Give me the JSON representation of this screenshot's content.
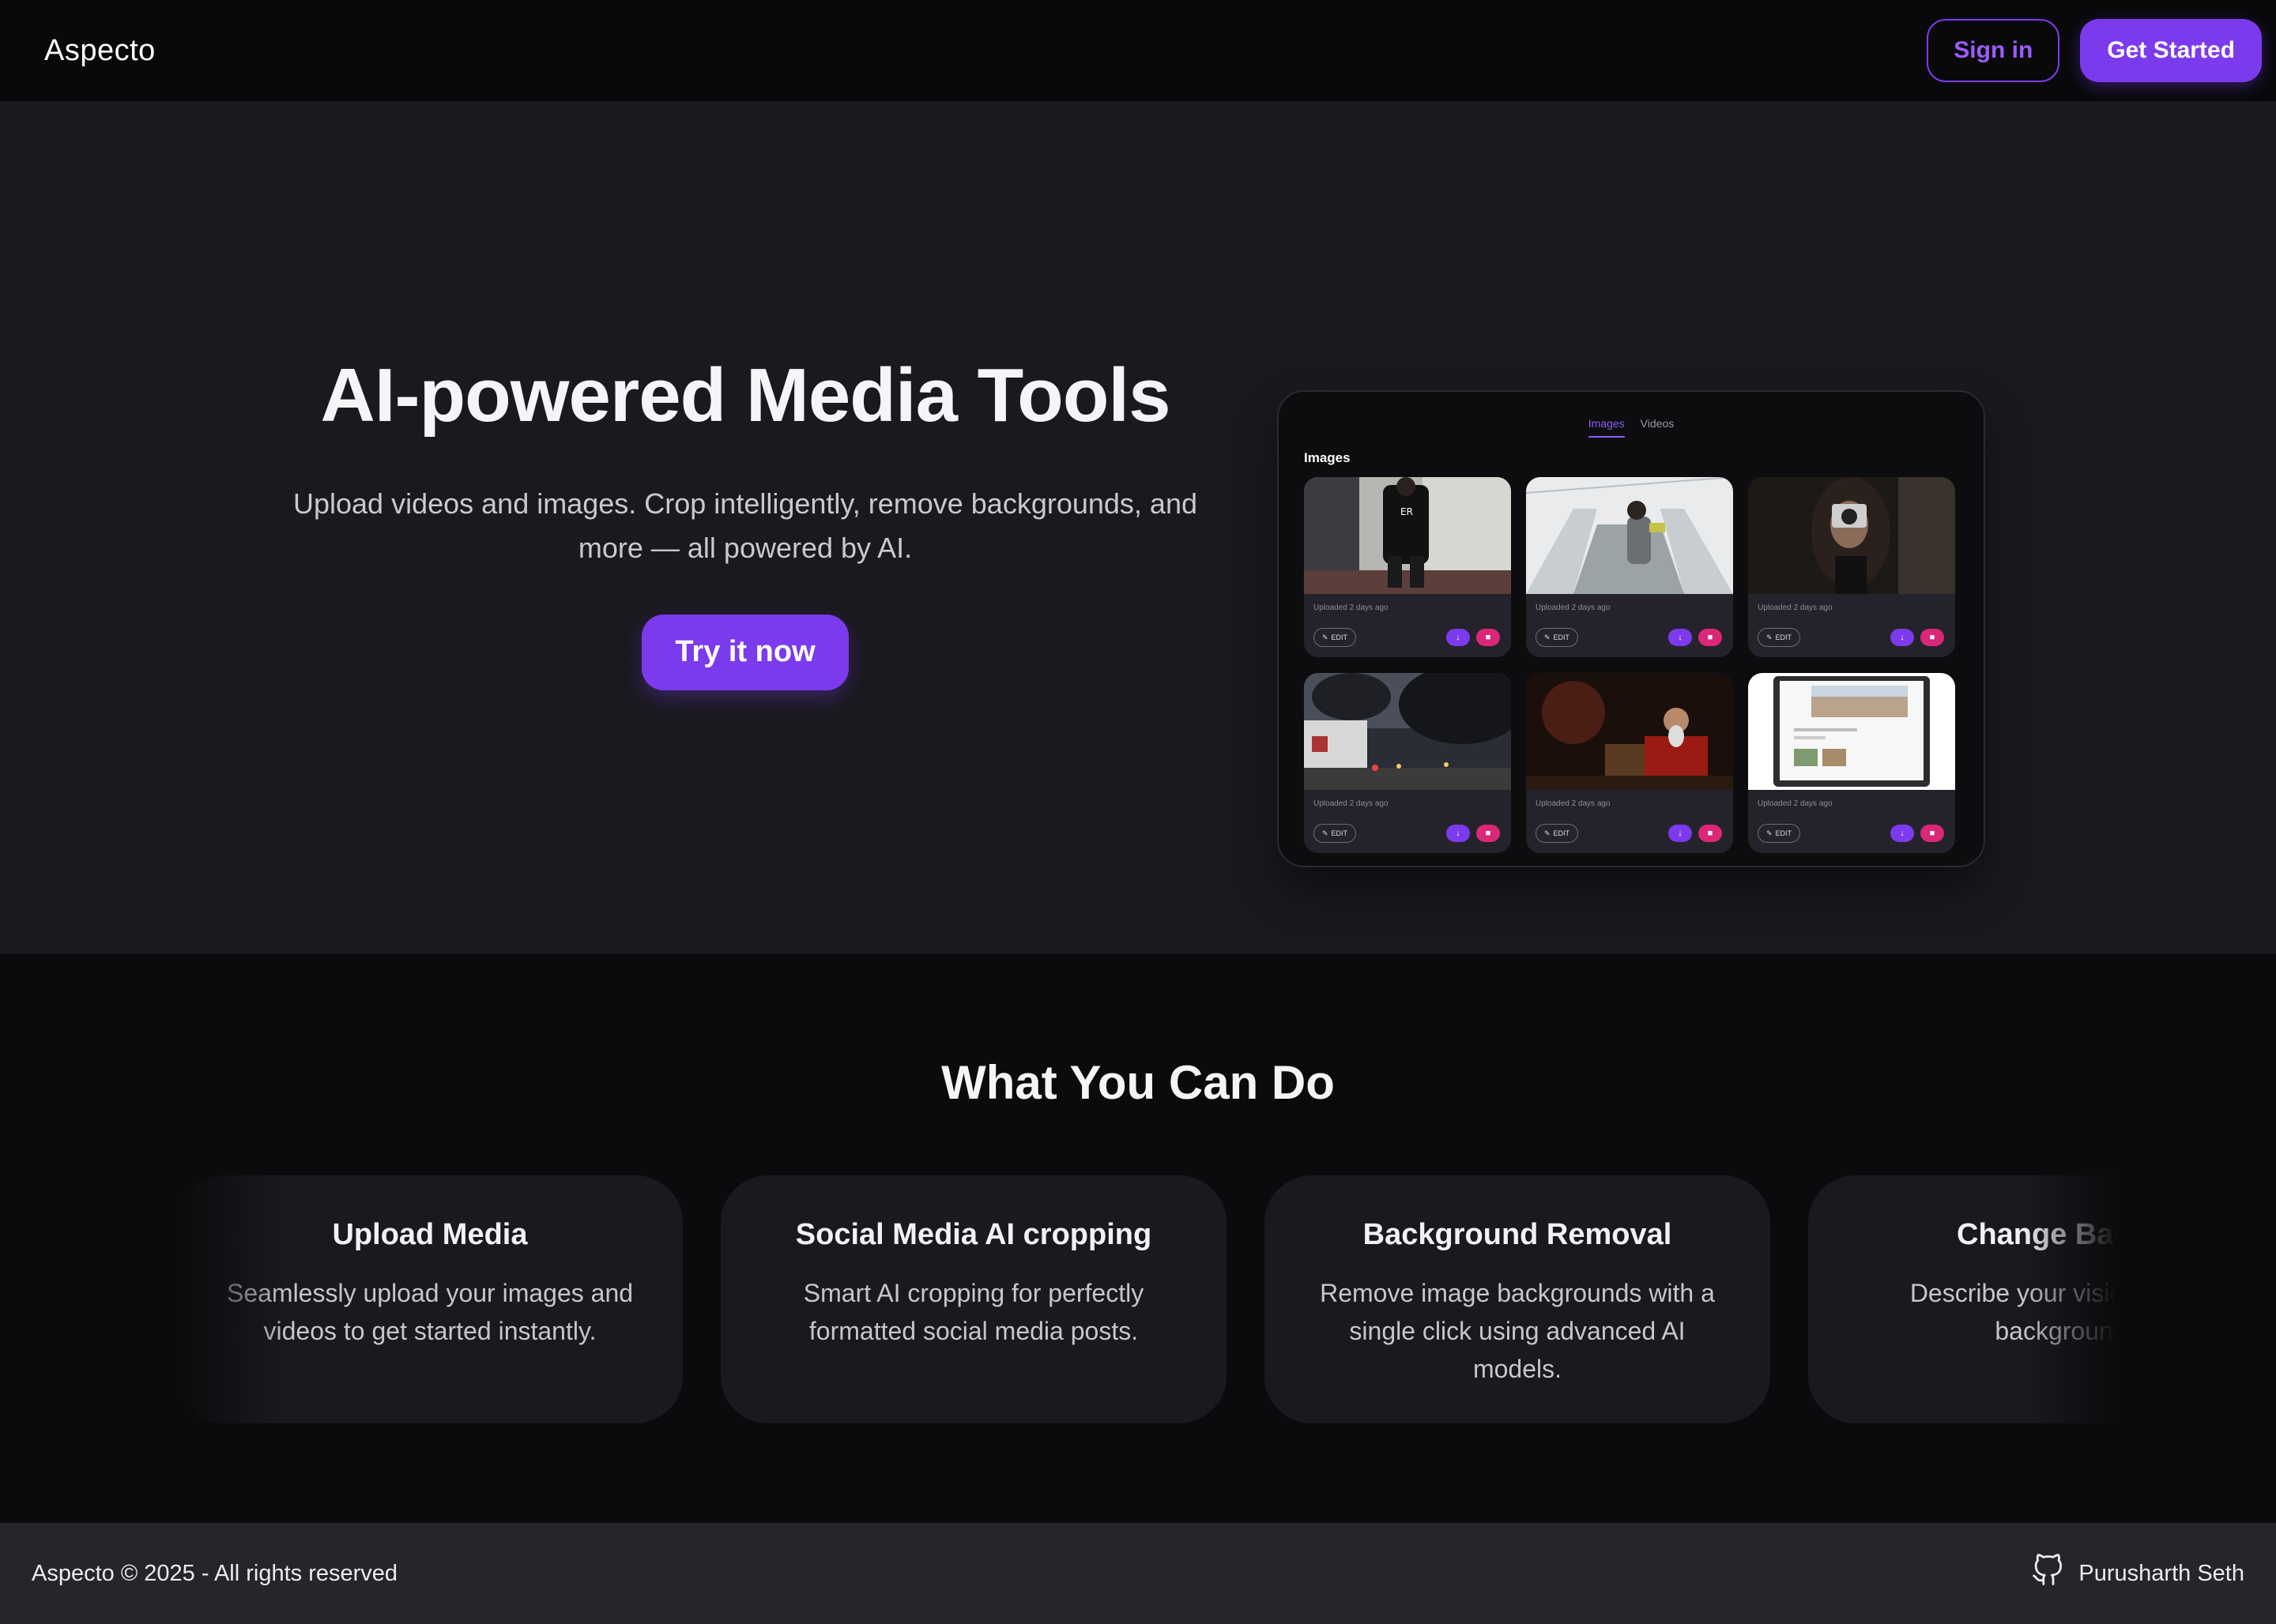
{
  "nav": {
    "brand": "Aspecto",
    "sign_in": "Sign in",
    "get_started": "Get Started"
  },
  "hero": {
    "title": "AI-powered Media Tools",
    "subtitle": "Upload videos and images. Crop intelligently, remove backgrounds, and more — all powered by AI.",
    "cta": "Try it now"
  },
  "preview": {
    "tabs": [
      "Images",
      "Videos"
    ],
    "active_tab": "Images",
    "heading": "Images",
    "cards": [
      {
        "meta": "Uploaded 2 days ago",
        "edit": "EDIT"
      },
      {
        "meta": "Uploaded 2 days ago",
        "edit": "EDIT"
      },
      {
        "meta": "Uploaded 2 days ago",
        "edit": "EDIT"
      },
      {
        "meta": "Uploaded 2 days ago",
        "edit": "EDIT"
      },
      {
        "meta": "Uploaded 2 days ago",
        "edit": "EDIT"
      },
      {
        "meta": "Uploaded 2 days ago",
        "edit": "EDIT"
      }
    ]
  },
  "features": {
    "title": "What You Can Do",
    "cards": [
      {
        "title": "Upload Media",
        "desc": "Seamlessly upload your images and videos to get started instantly."
      },
      {
        "title": "Social Media AI cropping",
        "desc": "Smart AI cropping for perfectly formatted social media posts."
      },
      {
        "title": "Background Removal",
        "desc": "Remove image backgrounds with a single click using advanced AI models."
      },
      {
        "title": "Change Backg",
        "desc": "Describe your vision — the background"
      }
    ]
  },
  "footer": {
    "copyright": "Aspecto © 2025 - All rights reserved",
    "author": "Purusharth Seth"
  },
  "colors": {
    "accent": "#7c3aed",
    "danger": "#db2777",
    "hero_bg": "#1a191f",
    "page_bg": "#0b0b0d",
    "footer_bg": "#25252b"
  }
}
